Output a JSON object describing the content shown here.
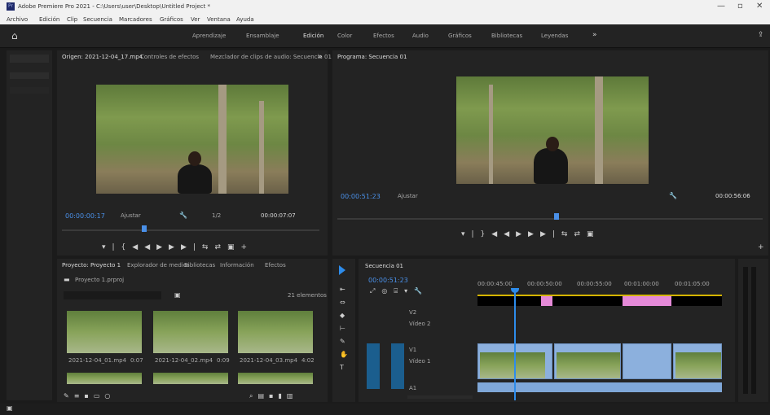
{
  "window": {
    "app_title": "Adobe Premiere Pro 2021 - C:\\Users\\user\\Desktop\\Untitled Project *",
    "minimize": "—",
    "maximize": "▫",
    "close": "✕"
  },
  "menu": [
    "Archivo",
    "Edición",
    "Clip",
    "Secuencia",
    "Marcadores",
    "Gráficos",
    "Ver",
    "Ventana",
    "Ayuda"
  ],
  "workspaces": [
    "Aprendizaje",
    "Ensamblaje",
    "Edición",
    "Color",
    "Efectos",
    "Audio",
    "Gráficos",
    "Bibliotecas",
    "Leyendas"
  ],
  "source_panel": {
    "tabs": [
      "Origen: 2021-12-04_17.mp4",
      "Controles de efectos",
      "Mezclador de clips de audio: Secuencia 01"
    ],
    "timecode": "00:00:00:17",
    "fit": "Ajustar",
    "ratio": "1/2",
    "duration": "00:00:07:07"
  },
  "program_panel": {
    "tab": "Programa: Secuencia 01",
    "timecode": "00:00:51:23",
    "fit": "Ajustar",
    "duration": "00:00:56:06"
  },
  "project_panel": {
    "tabs": [
      "Proyecto: Proyecto 1",
      "Explorador de medios",
      "Bibliotecas",
      "Información",
      "Efectos"
    ],
    "project_file": "Proyecto 1.prproj",
    "items_count": "21 elementos",
    "thumbs": [
      {
        "name": "2021-12-04_01.mp4",
        "dur": "0:07"
      },
      {
        "name": "2021-12-04_02.mp4",
        "dur": "0:09"
      },
      {
        "name": "2021-12-04_03.mp4",
        "dur": "4:02"
      }
    ]
  },
  "timeline": {
    "tab": "Secuencia 01",
    "timecode": "00:00:51:23",
    "ruler": [
      "00:00:45:00",
      "00:00:50:00",
      "00:00:55:00",
      "00:01:00:00",
      "00:01:05:00"
    ],
    "tracks": [
      {
        "id": "V2",
        "label": "Vídeo 2"
      },
      {
        "id": "V1",
        "label": "Vídeo 1"
      },
      {
        "id": "A1",
        "label": "A1"
      }
    ]
  },
  "colors": {
    "accent": "#2d8ceb",
    "clip_video": "#8cb0dd",
    "clip_pink": "#e58ad8",
    "track_control": "#1b5e8e"
  }
}
